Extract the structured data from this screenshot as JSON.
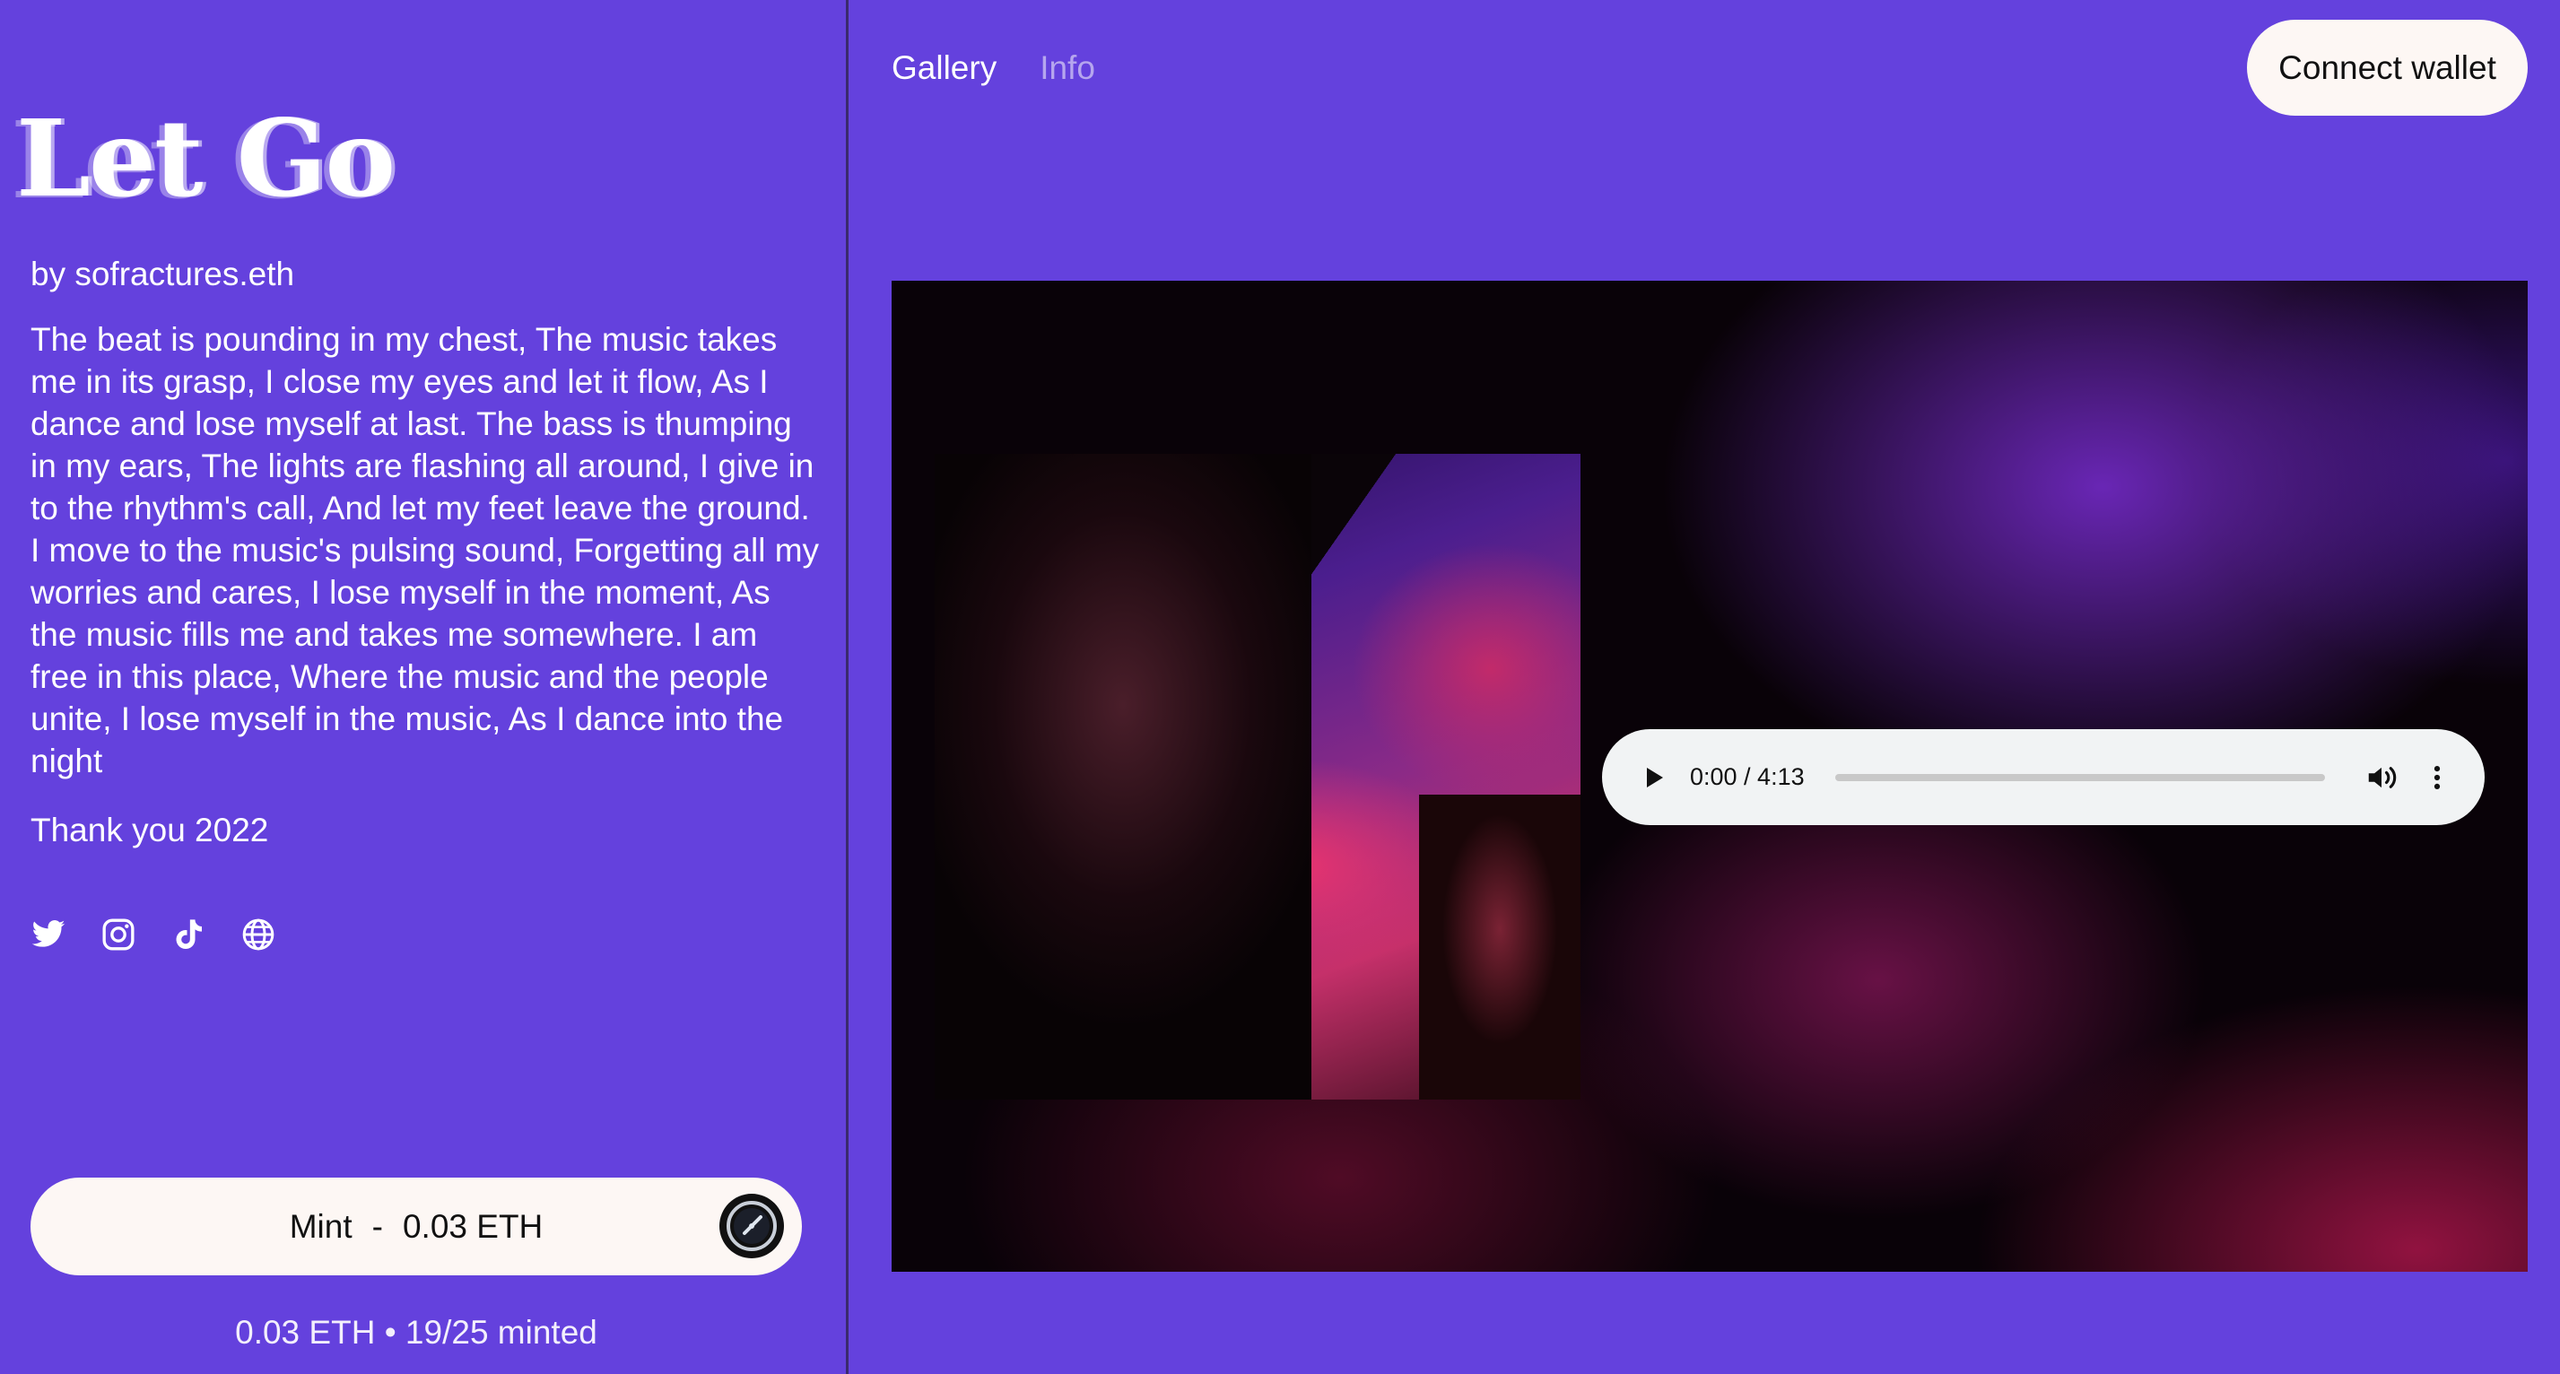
{
  "sidebar": {
    "title": "Let Go",
    "byline": "by sofractures.eth",
    "description": "The beat is pounding in my chest, The music takes me in its grasp, I close my eyes and let it flow, As I dance and lose myself at last. The bass is thumping in my ears, The lights are flashing all around, I give in to the rhythm's call, And let my feet leave the ground. I move to the music's pulsing sound, Forgetting all my worries and cares, I lose myself in the moment, As the music fills me and takes me somewhere. I am free in this place, Where the music and the people unite, I lose myself in the music, As I dance into the night",
    "thanks": "Thank you 2022",
    "socials": [
      "twitter-icon",
      "instagram-icon",
      "tiktok-icon",
      "globe-icon"
    ],
    "mint": {
      "label": "Mint",
      "separator": "-",
      "price": "0.03 ETH",
      "icon": "speedometer-icon"
    },
    "stats": "0.03 ETH • 19/25 minted"
  },
  "nav": {
    "tabs": [
      {
        "label": "Gallery",
        "active": true
      },
      {
        "label": "Info",
        "active": false
      }
    ],
    "connect_label": "Connect wallet"
  },
  "player": {
    "time": "0:00 / 4:13",
    "progress": 0
  },
  "colors": {
    "background": "#6441dd",
    "button_bg": "#fdf7f4",
    "inactive_tab": "#b6a6ee",
    "player_bg": "#f1f3f4"
  }
}
